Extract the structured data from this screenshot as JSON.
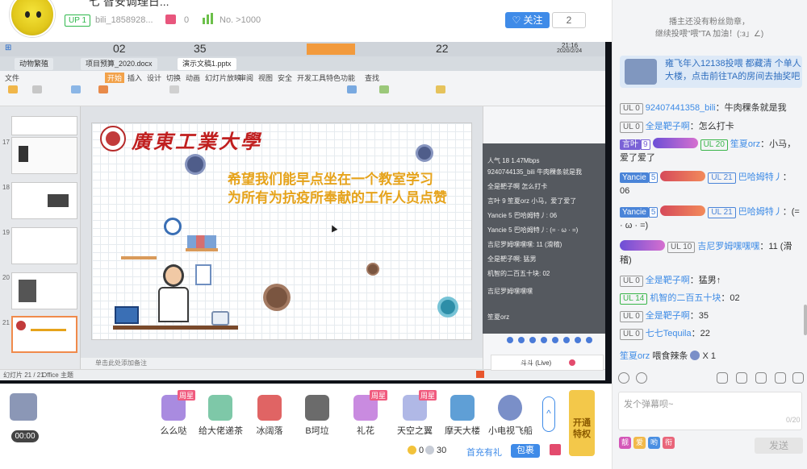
{
  "header": {
    "title_partial": "七   智安调理日...",
    "up_badge": "UP 1",
    "username": "bili_1858928...",
    "gift_count": "0",
    "rank": "No. >1000",
    "follow_label": "关注",
    "follow_count": "2"
  },
  "screen": {
    "taskbar_time": "21:16",
    "taskbar_date": "2020/2/24",
    "taskbar_numbers": [
      "02",
      "35",
      "22"
    ],
    "file_tabs": [
      "动物繁殖",
      "项目预算_2020.docx",
      "演示文稿1.pptx"
    ],
    "ribbon_tabs": [
      "文件",
      "开始",
      "插入",
      "设计",
      "切换",
      "动画",
      "幻灯片放映",
      "审阅",
      "视图",
      "安全",
      "开发工具",
      "特色功能",
      "查找"
    ],
    "slide": {
      "university": "廣東工業大學",
      "line1": "希望我们能早点坐在一个教室学习",
      "line2": "为所有为抗疫所奉献的工作人员点赞"
    },
    "notes_placeholder": "单击此处添加备注",
    "status_left": "幻灯片 21 / 21",
    "status_theme": "Office 主题",
    "thumb_numbers": [
      "17",
      "18",
      "19",
      "20",
      "21"
    ],
    "overlay_lines": [
      "人气 18  1.47Mbps",
      "9240744135_bili 牛肉稞条就是我",
      "全是靶子啊 怎么打卡",
      "言叶 9 笙夏orz 小马，爱了爱了",
      "Yancie 5 巴哈姆特丿: 06",
      "Yancie 5 巴哈姆特丿: (= · ω · =)",
      "吉尼罗姆嘿嘿嘿: 11 (滑稽)",
      "全是靶子啊: 猛男",
      "机智的二百五十块: 02",
      "吉尼罗姆嘿嘿嘿",
      "笙夏orz"
    ],
    "player_name": "斗斗 (Live)"
  },
  "gifts": {
    "timer": "00:00",
    "items": [
      {
        "label": "么么哒",
        "star": "周星"
      },
      {
        "label": "给大佬递茶",
        "star": ""
      },
      {
        "label": "冰阔落",
        "star": ""
      },
      {
        "label": "B坷垃",
        "star": ""
      },
      {
        "label": "礼花",
        "star": "周星"
      },
      {
        "label": "天空之翼",
        "star": "周星"
      },
      {
        "label": "摩天大楼",
        "star": ""
      },
      {
        "label": "小电视飞船",
        "star": ""
      }
    ],
    "more": "^",
    "vip_label": "开通特权",
    "gold": "0",
    "silver": "30",
    "first_pay": "首充有礼",
    "package": "包裹"
  },
  "chat": {
    "fan_notice_line1": "播主还没有粉丝勋章，",
    "fan_notice_line2": "继续投喂\"喂\"TA 加油！(:з」∠)",
    "banner_text_line1": "雍飞年入12138投喂 都藏清 个单人",
    "banner_text_line2": "大楼，点击前往TA的房间去抽奖吧",
    "messages": [
      {
        "lv": "UL 0",
        "name": "92407441358_bili",
        "text": "：牛肉稞条就是我"
      },
      {
        "lv": "UL 0",
        "name": "全是靶子啊",
        "text": "：怎么打卡"
      },
      {
        "medal": "言叶",
        "mnum": "9",
        "ul": "UL 20",
        "name": "笙夏orz",
        "text": "：小马，爱了爱了"
      },
      {
        "medal": "Yancie",
        "mnum": "5",
        "ul": "UL 21",
        "name": "巴哈姆特丿",
        "text": "：06"
      },
      {
        "medal": "Yancie",
        "mnum": "5",
        "ul": "UL 21",
        "name": "巴哈姆特丿",
        "text": "：(= · ω · =)"
      },
      {
        "ul": "UL 10",
        "name": "吉尼罗姆嘿嘿嘿",
        "text": "：11 (滑稽)"
      },
      {
        "lv": "UL 0",
        "name": "全是靶子啊",
        "text": "：猛男↑"
      },
      {
        "lv": "UL 14",
        "name": "机智的二百五十块",
        "text": "：02"
      },
      {
        "lv": "UL 0",
        "name": "全是靶子啊",
        "text": "：35"
      },
      {
        "lv": "UL 0",
        "name": "七七Tequila",
        "text": "：22"
      }
    ],
    "gift_line_name": "笙夏orz",
    "gift_line_text": "喂食辣条",
    "gift_line_count": "X 1",
    "input_placeholder": "发个弹幕呗~",
    "input_count": "0/20",
    "style_buttons": [
      "靓",
      "爱",
      "哟",
      "衔"
    ],
    "send_label": "发送"
  },
  "colors": {
    "accent_blue": "#3f8be8",
    "level_green": "#3ab54a",
    "slide_gold": "#e6a31b",
    "slide_red": "#c01f1f"
  }
}
